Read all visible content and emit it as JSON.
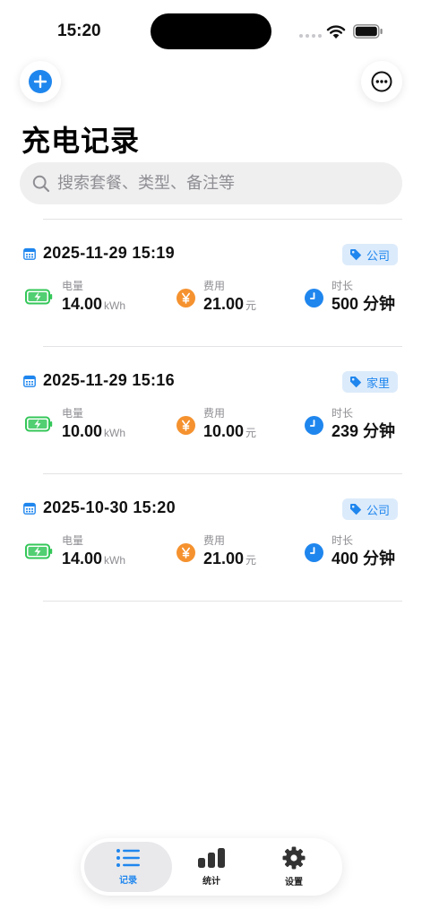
{
  "status_bar": {
    "time": "15:20"
  },
  "page": {
    "title": "充电记录"
  },
  "search": {
    "placeholder": "搜索套餐、类型、备注等"
  },
  "labels": {
    "energy": "电量",
    "cost": "费用",
    "duration": "时长",
    "energy_unit": "kWh",
    "cost_unit": "元"
  },
  "records": [
    {
      "datetime": "2025-11-29 15:19",
      "tag": "公司",
      "energy": "14.00",
      "cost": "21.00",
      "duration": "500 分钟"
    },
    {
      "datetime": "2025-11-29 15:16",
      "tag": "家里",
      "energy": "10.00",
      "cost": "10.00",
      "duration": "239 分钟"
    },
    {
      "datetime": "2025-10-30 15:20",
      "tag": "公司",
      "energy": "14.00",
      "cost": "21.00",
      "duration": "400 分钟"
    }
  ],
  "tab_bar": {
    "records": "记录",
    "stats": "统计",
    "settings": "设置"
  },
  "colors": {
    "accent": "#1f86ee",
    "energy_green": "#34c759",
    "cost_orange": "#f5922f",
    "tag_bg": "#dcebfb"
  },
  "icons": {
    "add": "plus-circle-icon",
    "more": "ellipsis-circle-icon",
    "search": "magnifier-icon",
    "calendar": "calendar-icon",
    "tag": "tag-icon",
    "battery": "battery-charging-icon",
    "yen": "yen-circle-icon",
    "clock": "clock-icon",
    "list": "list-icon",
    "chart": "bar-chart-icon",
    "gear": "gear-icon"
  }
}
